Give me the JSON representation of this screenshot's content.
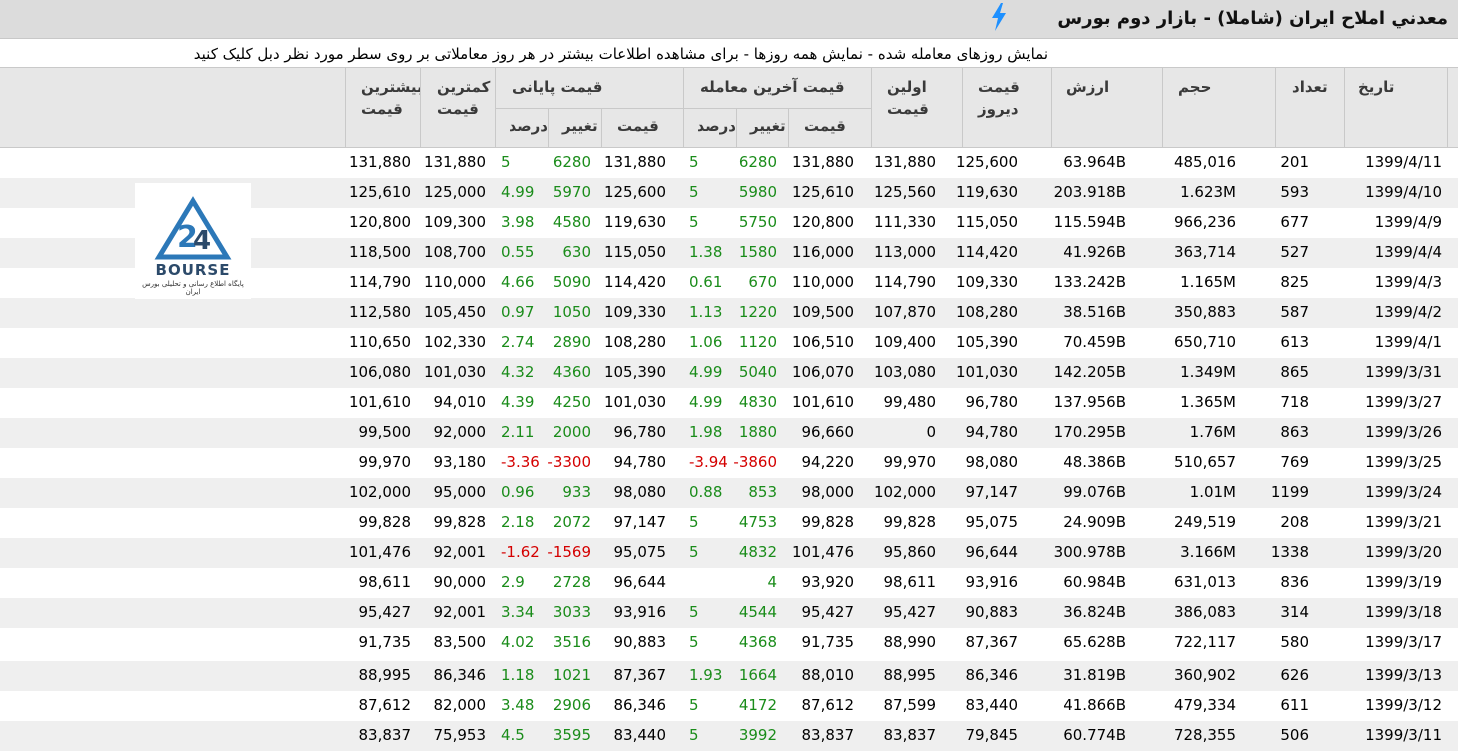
{
  "title": "معدني املاح ايران (شاملا) - بازار دوم بورس",
  "notice": {
    "link1": "نمایش روزهای معامله شده",
    "sep1": " - ",
    "link2": "نمایش همه روزها",
    "sep2": " - ",
    "message": "برای مشاهده اطلاعات بیشتر در هر روز معاملاتی بر روی سطر مورد نظر دبل کلیک کنید"
  },
  "headers": {
    "date": "تاریخ",
    "count": "تعداد",
    "volume": "حجم",
    "value": "ارزش",
    "yesterday_l1": "قیمت",
    "yesterday_l2": "دیروز",
    "first_l1": "اولین",
    "first_l2": "قیمت",
    "last_group": "قیمت آخرین معامله",
    "closing_group": "قیمت پایانی",
    "price": "قیمت",
    "change": "تغییر",
    "percent": "درصد",
    "min_l1": "کمترین",
    "min_l2": "قیمت",
    "max_l1": "بیشترین",
    "max_l2": "قیمت"
  },
  "logo": {
    "text": "BOURSE",
    "subtitle": "پایگاه اطلاع رسانی و تحلیلی بورس ایران",
    "icon": "24-logo-icon"
  },
  "colors": {
    "positive": "#1a8c1a",
    "negative": "#d40000",
    "header_bg": "#e7e7e7",
    "alt_row": "#efefef"
  },
  "rows": [
    {
      "date": "1399/4/11",
      "count": "201",
      "volume": "485,016",
      "value": "63.964B",
      "yesterday": "125,600",
      "first": "131,880",
      "last_price": "131,880",
      "last_change": "6280",
      "last_pct": "5",
      "close_price": "131,880",
      "close_change": "6280",
      "close_pct": "5",
      "min": "131,880",
      "max": "131,880"
    },
    {
      "date": "1399/4/10",
      "count": "593",
      "volume": "1.623M",
      "value": "203.918B",
      "yesterday": "119,630",
      "first": "125,560",
      "last_price": "125,610",
      "last_change": "5980",
      "last_pct": "5",
      "close_price": "125,600",
      "close_change": "5970",
      "close_pct": "4.99",
      "min": "125,000",
      "max": "125,610"
    },
    {
      "date": "1399/4/9",
      "count": "677",
      "volume": "966,236",
      "value": "115.594B",
      "yesterday": "115,050",
      "first": "111,330",
      "last_price": "120,800",
      "last_change": "5750",
      "last_pct": "5",
      "close_price": "119,630",
      "close_change": "4580",
      "close_pct": "3.98",
      "min": "109,300",
      "max": "120,800"
    },
    {
      "date": "1399/4/4",
      "count": "527",
      "volume": "363,714",
      "value": "41.926B",
      "yesterday": "114,420",
      "first": "113,000",
      "last_price": "116,000",
      "last_change": "1580",
      "last_pct": "1.38",
      "close_price": "115,050",
      "close_change": "630",
      "close_pct": "0.55",
      "min": "108,700",
      "max": "118,500"
    },
    {
      "date": "1399/4/3",
      "count": "825",
      "volume": "1.165M",
      "value": "133.242B",
      "yesterday": "109,330",
      "first": "114,790",
      "last_price": "110,000",
      "last_change": "670",
      "last_pct": "0.61",
      "close_price": "114,420",
      "close_change": "5090",
      "close_pct": "4.66",
      "min": "110,000",
      "max": "114,790"
    },
    {
      "date": "1399/4/2",
      "count": "587",
      "volume": "350,883",
      "value": "38.516B",
      "yesterday": "108,280",
      "first": "107,870",
      "last_price": "109,500",
      "last_change": "1220",
      "last_pct": "1.13",
      "close_price": "109,330",
      "close_change": "1050",
      "close_pct": "0.97",
      "min": "105,450",
      "max": "112,580"
    },
    {
      "date": "1399/4/1",
      "count": "613",
      "volume": "650,710",
      "value": "70.459B",
      "yesterday": "105,390",
      "first": "109,400",
      "last_price": "106,510",
      "last_change": "1120",
      "last_pct": "1.06",
      "close_price": "108,280",
      "close_change": "2890",
      "close_pct": "2.74",
      "min": "102,330",
      "max": "110,650"
    },
    {
      "date": "1399/3/31",
      "count": "865",
      "volume": "1.349M",
      "value": "142.205B",
      "yesterday": "101,030",
      "first": "103,080",
      "last_price": "106,070",
      "last_change": "5040",
      "last_pct": "4.99",
      "close_price": "105,390",
      "close_change": "4360",
      "close_pct": "4.32",
      "min": "101,030",
      "max": "106,080"
    },
    {
      "date": "1399/3/27",
      "count": "718",
      "volume": "1.365M",
      "value": "137.956B",
      "yesterday": "96,780",
      "first": "99,480",
      "last_price": "101,610",
      "last_change": "4830",
      "last_pct": "4.99",
      "close_price": "101,030",
      "close_change": "4250",
      "close_pct": "4.39",
      "min": "94,010",
      "max": "101,610"
    },
    {
      "date": "1399/3/26",
      "count": "863",
      "volume": "1.76M",
      "value": "170.295B",
      "yesterday": "94,780",
      "first": "0",
      "last_price": "96,660",
      "last_change": "1880",
      "last_pct": "1.98",
      "close_price": "96,780",
      "close_change": "2000",
      "close_pct": "2.11",
      "min": "92,000",
      "max": "99,500"
    },
    {
      "date": "1399/3/25",
      "count": "769",
      "volume": "510,657",
      "value": "48.386B",
      "yesterday": "98,080",
      "first": "99,970",
      "last_price": "94,220",
      "last_change": "-3860",
      "last_pct": "-3.94",
      "close_price": "94,780",
      "close_change": "-3300",
      "close_pct": "-3.36",
      "min": "93,180",
      "max": "99,970"
    },
    {
      "date": "1399/3/24",
      "count": "1199",
      "volume": "1.01M",
      "value": "99.076B",
      "yesterday": "97,147",
      "first": "102,000",
      "last_price": "98,000",
      "last_change": "853",
      "last_pct": "0.88",
      "close_price": "98,080",
      "close_change": "933",
      "close_pct": "0.96",
      "min": "95,000",
      "max": "102,000"
    },
    {
      "date": "1399/3/21",
      "count": "208",
      "volume": "249,519",
      "value": "24.909B",
      "yesterday": "95,075",
      "first": "99,828",
      "last_price": "99,828",
      "last_change": "4753",
      "last_pct": "5",
      "close_price": "97,147",
      "close_change": "2072",
      "close_pct": "2.18",
      "min": "99,828",
      "max": "99,828"
    },
    {
      "date": "1399/3/20",
      "count": "1338",
      "volume": "3.166M",
      "value": "300.978B",
      "yesterday": "96,644",
      "first": "95,860",
      "last_price": "101,476",
      "last_change": "4832",
      "last_pct": "5",
      "close_price": "95,075",
      "close_change": "-1569",
      "close_pct": "-1.62",
      "min": "92,001",
      "max": "101,476"
    },
    {
      "date": "1399/3/19",
      "count": "836",
      "volume": "631,013",
      "value": "60.984B",
      "yesterday": "93,916",
      "first": "98,611",
      "last_price": "93,920",
      "last_change": "4",
      "last_pct": "",
      "close_price": "96,644",
      "close_change": "2728",
      "close_pct": "2.9",
      "min": "90,000",
      "max": "98,611"
    },
    {
      "date": "1399/3/18",
      "count": "314",
      "volume": "386,083",
      "value": "36.824B",
      "yesterday": "90,883",
      "first": "95,427",
      "last_price": "95,427",
      "last_change": "4544",
      "last_pct": "5",
      "close_price": "93,916",
      "close_change": "3033",
      "close_pct": "3.34",
      "min": "92,001",
      "max": "95,427"
    },
    {
      "date": "1399/3/17",
      "count": "580",
      "volume": "722,117",
      "value": "65.628B",
      "yesterday": "87,367",
      "first": "88,990",
      "last_price": "91,735",
      "last_change": "4368",
      "last_pct": "5",
      "close_price": "90,883",
      "close_change": "3516",
      "close_pct": "4.02",
      "min": "83,500",
      "max": "91,735"
    },
    {
      "date": "1399/3/13",
      "count": "626",
      "volume": "360,902",
      "value": "31.819B",
      "yesterday": "86,346",
      "first": "88,995",
      "last_price": "88,010",
      "last_change": "1664",
      "last_pct": "1.93",
      "close_price": "87,367",
      "close_change": "1021",
      "close_pct": "1.18",
      "min": "86,346",
      "max": "88,995"
    },
    {
      "date": "1399/3/12",
      "count": "611",
      "volume": "479,334",
      "value": "41.866B",
      "yesterday": "83,440",
      "first": "87,599",
      "last_price": "87,612",
      "last_change": "4172",
      "last_pct": "5",
      "close_price": "86,346",
      "close_change": "2906",
      "close_pct": "3.48",
      "min": "82,000",
      "max": "87,612"
    },
    {
      "date": "1399/3/11",
      "count": "506",
      "volume": "728,355",
      "value": "60.774B",
      "yesterday": "79,845",
      "first": "83,837",
      "last_price": "83,837",
      "last_change": "3992",
      "last_pct": "5",
      "close_price": "83,440",
      "close_change": "3595",
      "close_pct": "4.5",
      "min": "75,953",
      "max": "83,837"
    }
  ]
}
